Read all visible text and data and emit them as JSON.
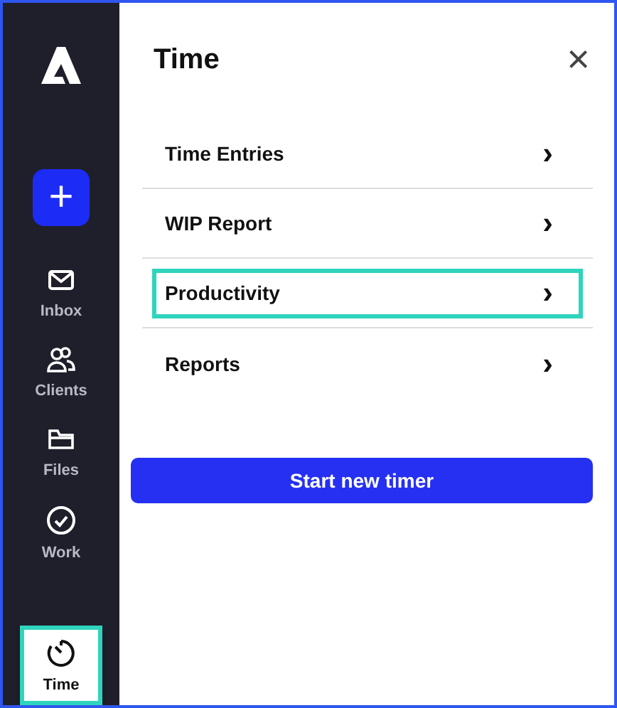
{
  "sidebar": {
    "new_button": "+",
    "items": [
      {
        "kind": "envelope",
        "label": "Inbox",
        "selected": false,
        "highlighted": false
      },
      {
        "kind": "people",
        "label": "Clients",
        "selected": false,
        "highlighted": false
      },
      {
        "kind": "folder",
        "label": "Files",
        "selected": false,
        "highlighted": false
      },
      {
        "kind": "check",
        "label": "Work",
        "selected": false,
        "highlighted": false
      },
      {
        "kind": "timer",
        "label": "Time",
        "selected": true,
        "highlighted": true
      }
    ]
  },
  "panel": {
    "title": "Time",
    "close": "×",
    "items": [
      {
        "label": "Time Entries",
        "arrow": "›",
        "highlighted": false
      },
      {
        "label": "WIP Report",
        "arrow": "›",
        "highlighted": false
      },
      {
        "label": "Productivity",
        "arrow": "›",
        "highlighted": true
      },
      {
        "label": "Reports",
        "arrow": "›",
        "highlighted": false
      }
    ],
    "button": "Start new timer"
  }
}
